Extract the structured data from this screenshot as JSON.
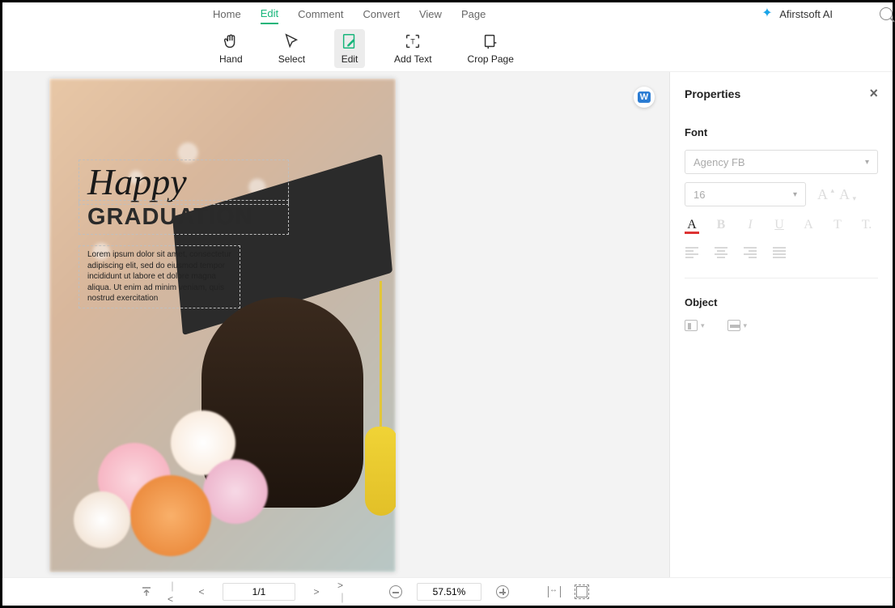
{
  "menu": {
    "home": "Home",
    "edit": "Edit",
    "comment": "Comment",
    "convert": "Convert",
    "view": "View",
    "page": "Page",
    "ai_brand": "Afirstsoft AI"
  },
  "toolbar": {
    "hand": "Hand",
    "select": "Select",
    "edit": "Edit",
    "addtext": "Add Text",
    "croppage": "Crop Page"
  },
  "document": {
    "happy": "Happy",
    "graduation": "GRADUATION",
    "lorem": "Lorem ipsum dolor sit amet, consectetur adipiscing elit, sed do eiusmod tempor incididunt ut labore et dolore magna aliqua. Ut enim ad minim veniam, quis nostrud exercitation"
  },
  "properties": {
    "title": "Properties",
    "font_section": "Font",
    "font_family": "Agency FB",
    "font_size": "16",
    "object_section": "Object"
  },
  "bottombar": {
    "page": "1/1",
    "zoom": "57.51%"
  }
}
